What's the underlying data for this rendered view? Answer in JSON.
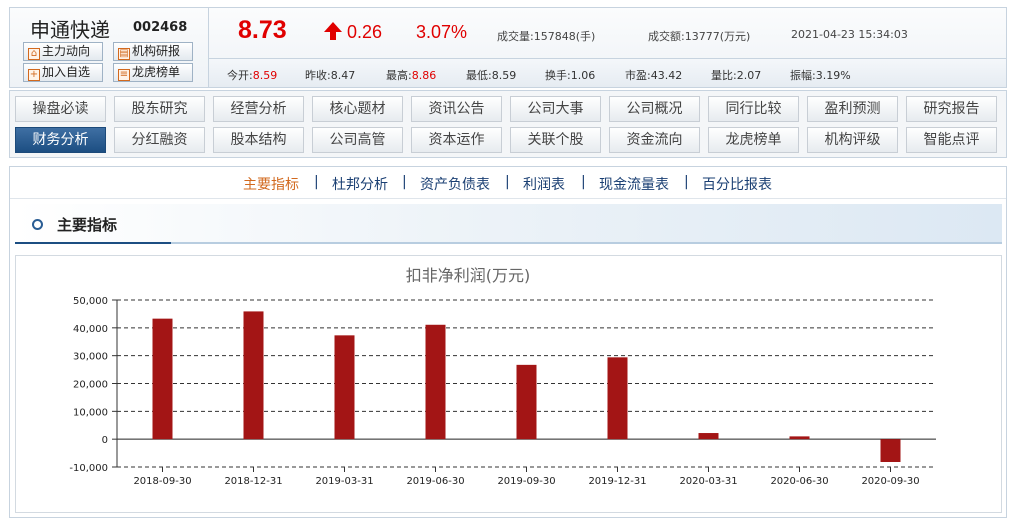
{
  "stock": {
    "name": "申通快递",
    "code": "002468",
    "price": "8.73",
    "change": "0.26",
    "change_pct": "3.07%",
    "volume_label": "成交量:",
    "volume": "157848(手)",
    "amount_label": "成交额:",
    "amount": "13777(万元)",
    "datetime": "2021-04-23 15:34:03",
    "up_color": "#e00000",
    "arrow_icon": "up-arrow-icon"
  },
  "quick_buttons": [
    {
      "label": "主力动向",
      "icon": "chart-icon"
    },
    {
      "label": "机构研报",
      "icon": "report-icon"
    },
    {
      "label": "加入自选",
      "icon": "plus-icon"
    },
    {
      "label": "龙虎榜单",
      "icon": "list-icon"
    }
  ],
  "stats": [
    {
      "label": "今开:",
      "value": "8.59",
      "red": true
    },
    {
      "label": "昨收:",
      "value": "8.47",
      "red": false
    },
    {
      "label": "最高:",
      "value": "8.86",
      "red": true
    },
    {
      "label": "最低:",
      "value": "8.59",
      "red": false
    },
    {
      "label": "换手:",
      "value": "1.06",
      "red": false
    },
    {
      "label": "市盈:",
      "value": "43.42",
      "red": false
    },
    {
      "label": "量比:",
      "value": "2.07",
      "red": false
    },
    {
      "label": "振幅:",
      "value": "3.19%",
      "red": false
    }
  ],
  "nav": {
    "row1": [
      "操盘必读",
      "股东研究",
      "经营分析",
      "核心题材",
      "资讯公告",
      "公司大事",
      "公司概况",
      "同行比较",
      "盈利预测",
      "研究报告"
    ],
    "row2": [
      "财务分析",
      "分红融资",
      "股本结构",
      "公司高管",
      "资本运作",
      "关联个股",
      "资金流向",
      "龙虎榜单",
      "机构评级",
      "智能点评"
    ],
    "active": "财务分析",
    "active_color": "#1c4e82"
  },
  "subtabs": {
    "items": [
      "主要指标",
      "杜邦分析",
      "资产负债表",
      "利润表",
      "现金流量表",
      "百分比报表"
    ],
    "separator": "|",
    "active": "主要指标",
    "active_color": "#d2691e"
  },
  "section": {
    "title": "主要指标"
  },
  "chart_data": {
    "type": "bar",
    "title": "扣非净利润(万元)",
    "categories": [
      "2018-09-30",
      "2018-12-31",
      "2019-03-31",
      "2019-06-30",
      "2019-09-30",
      "2019-12-31",
      "2020-03-31",
      "2020-06-30",
      "2020-09-30"
    ],
    "values": [
      43300,
      45900,
      37300,
      41100,
      26700,
      29400,
      2200,
      1000,
      -8200
    ],
    "ylim": [
      -10000,
      50000
    ],
    "yticks": [
      "-10,000",
      "0",
      "10,000",
      "20,000",
      "30,000",
      "40,000",
      "50,000"
    ],
    "grid": true,
    "bar_color": "#a31515"
  }
}
